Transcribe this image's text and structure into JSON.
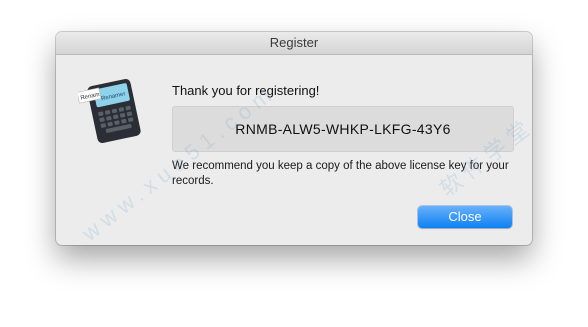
{
  "window": {
    "title": "Register"
  },
  "icon": {
    "name": "renamer-app-icon",
    "label_front": "Renamer",
    "label_tag": "Renam"
  },
  "content": {
    "heading": "Thank you for registering!",
    "license_key": "RNMB-ALW5-WHKP-LKFG-43Y6",
    "note": "We recommend you keep a copy of the above license key for your records."
  },
  "buttons": {
    "close_label": "Close"
  },
  "watermark": {
    "left": "www.xue51.com",
    "right": "软件学堂"
  },
  "colors": {
    "accent": "#0d80f2",
    "window_bg": "#ececec",
    "key_box_bg": "#dcdcdc"
  }
}
